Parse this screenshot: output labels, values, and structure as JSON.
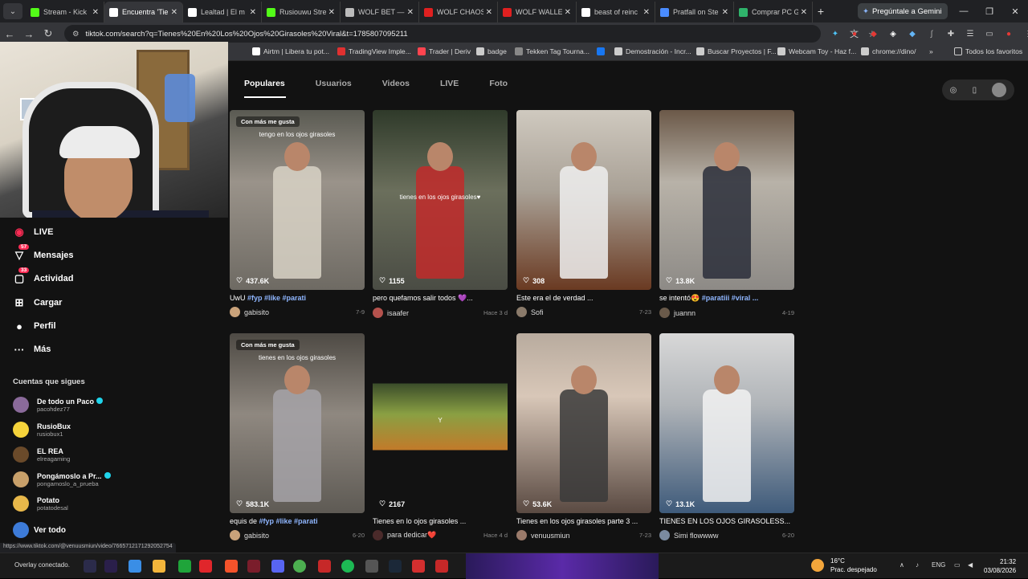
{
  "browser": {
    "tabs": [
      {
        "title": "Stream - Kick",
        "color": "#53fc18"
      },
      {
        "title": "Encuentra 'Tie",
        "color": "#ffffff",
        "active": true
      },
      {
        "title": "Lealtad | El m",
        "color": "#ffffff"
      },
      {
        "title": "Rusiouwu Stre",
        "color": "#53fc18"
      },
      {
        "title": "WOLF BET —",
        "color": "#bbbbbb"
      },
      {
        "title": "WOLF CHAOS",
        "color": "#e02020"
      },
      {
        "title": "WOLF WALLE",
        "color": "#e02020"
      },
      {
        "title": "beast of reinc",
        "color": "#ffffff"
      },
      {
        "title": "Pratfall on Ste",
        "color": "#4a8cff"
      },
      {
        "title": "Comprar PC G",
        "color": "#2fb36b"
      }
    ],
    "gemini_label": "Pregúntale a Gemini",
    "url": "tiktok.com/search?q=Tienes%20En%20Los%20Ojos%20Girasoles%20Viral&t=1785807095211",
    "bookmarks": [
      {
        "label": "Airtm | Libera tu pot...",
        "color": "#ffffff"
      },
      {
        "label": "TradingView Imple...",
        "color": "#e03030"
      },
      {
        "label": "Trader | Deriv",
        "color": "#ff444f"
      },
      {
        "label": "badge",
        "color": "#cccccc"
      },
      {
        "label": "Tekken Tag Tourna...",
        "color": "#888888"
      },
      {
        "label": "",
        "color": "#1877f2"
      },
      {
        "label": "Demostración - Incr...",
        "color": "#cccccc"
      },
      {
        "label": "Buscar Proyectos | F...",
        "color": "#cccccc"
      },
      {
        "label": "Webcam Toy - Haz f...",
        "color": "#cccccc"
      },
      {
        "label": "chrome://dino/",
        "color": "#cccccc"
      }
    ],
    "bookmarks_more": "»",
    "all_favorites": "Todos los favoritos",
    "status_url": "https://www.tiktok.com/@venuusmiun/video/7665712171292052754"
  },
  "sidebar": {
    "items": [
      {
        "label": "LIVE",
        "icon": "live-icon"
      },
      {
        "label": "Mensajes",
        "icon": "messages-icon",
        "badge": "57"
      },
      {
        "label": "Actividad",
        "icon": "activity-icon",
        "badge": "33"
      },
      {
        "label": "Cargar",
        "icon": "upload-icon"
      },
      {
        "label": "Perfil",
        "icon": "profile-icon"
      },
      {
        "label": "Más",
        "icon": "more-icon"
      }
    ],
    "following_header": "Cuentas que sigues",
    "following": [
      {
        "name": "De todo un Paco",
        "handle": "pacohdez77",
        "verified": true,
        "color": "#8a6a9a"
      },
      {
        "name": "RusioBux",
        "handle": "rusiobux1",
        "verified": false,
        "color": "#f5d33b"
      },
      {
        "name": "EL REA",
        "handle": "elreagaming",
        "verified": false,
        "color": "#6a4a2a"
      },
      {
        "name": "Pongámoslo a Pr...",
        "handle": "pongamoslo_a_prueba",
        "verified": true,
        "color": "#c8a06a"
      },
      {
        "name": "Potato",
        "handle": "potatodesal",
        "verified": false,
        "color": "#e8b84a"
      }
    ],
    "see_all": "Ver todo",
    "overlay_label": "Overlay conectado."
  },
  "search": {
    "tabs": [
      "Populares",
      "Usuarios",
      "Videos",
      "LIVE",
      "Foto"
    ],
    "active_tab": "Populares"
  },
  "videos": [
    {
      "tag": "Con más me gusta",
      "overlay": "tengo en los ojos girasoles",
      "likes": "437.6K",
      "caption_text": "UwU ",
      "hashtags": "#fyp #like #parati",
      "author": "gabisito",
      "date": "7-9",
      "bg": "linear-gradient(180deg,#5a5a52 0%,#9a938a 40%,#6e6a63 100%)"
    },
    {
      "tag": "",
      "overlay": "tienes en los ojos girasoles♥",
      "likes": "1155",
      "caption_text": "pero quefamos salir todos 💜...",
      "hashtags": "",
      "author": "isaafer",
      "date": "Hace 3 d",
      "bg": "linear-gradient(180deg,#2f3a2a 0%,#6b6f5c 45%,#4a4c44 100%)"
    },
    {
      "tag": "",
      "overlay": "",
      "likes": "308",
      "caption_text": "Este era el de verdad ...",
      "hashtags": "",
      "author": "Sofi",
      "date": "7-23",
      "bg": "linear-gradient(180deg,#cfc9bf 0%,#a9a196 45%,#6a3a22 100%)"
    },
    {
      "tag": "",
      "overlay": "",
      "likes": "13.8K",
      "caption_text": "se intentó😍 ",
      "hashtags": "#paratiii #viral ...",
      "author": "juannn",
      "date": "4-19",
      "bg": "linear-gradient(180deg,#6b5848 0%,#b8b2a8 40%,#8d8a86 100%)"
    },
    {
      "tag": "Con más me gusta",
      "overlay": "tienes en los ojos girasoles",
      "likes": "583.1K",
      "caption_text": "equis de ",
      "hashtags": "#fyp #like #parati",
      "author": "gabisito",
      "date": "6-20",
      "bg": "linear-gradient(180deg,#4e4a44 0%,#8f8880 45%,#5e5a54 100%)"
    },
    {
      "tag": "",
      "overlay": "Y",
      "likes": "2167",
      "caption_text": "Tienes en lo ojos girasoles ...",
      "hashtags": "",
      "author": "para dedicar❤️",
      "date": "Hace 4 d",
      "bg": "linear-gradient(180deg,#121212 0%,#121212 28%,#3b4d2a 28%,#8aa043 45%,#c27a2a 65%,#121212 65%,#121212 100%)"
    },
    {
      "tag": "",
      "overlay": "",
      "likes": "53.6K",
      "caption_text": "Tienes en los ojos girasoles parte 3 ...",
      "hashtags": "",
      "author": "venuusmiun",
      "date": "7-23",
      "bg": "linear-gradient(180deg,#b8ab9e 0%,#d8c7b8 35%,#5a4a42 100%)"
    },
    {
      "tag": "",
      "overlay": "",
      "likes": "13.1K",
      "caption_text": "TIENES EN LOS OJOS GIRASOLESS...",
      "hashtags": "",
      "author": "Simi flowwww",
      "date": "6-20",
      "bg": "linear-gradient(180deg,#d8d8d8 0%,#b0b4b8 40%,#3e5a7a 100%)"
    }
  ],
  "taskbar": {
    "weather_temp": "16°C",
    "weather_desc": "Prac. despejado",
    "lang": "ENG",
    "time": "21:32",
    "date": "03/08/2026"
  }
}
